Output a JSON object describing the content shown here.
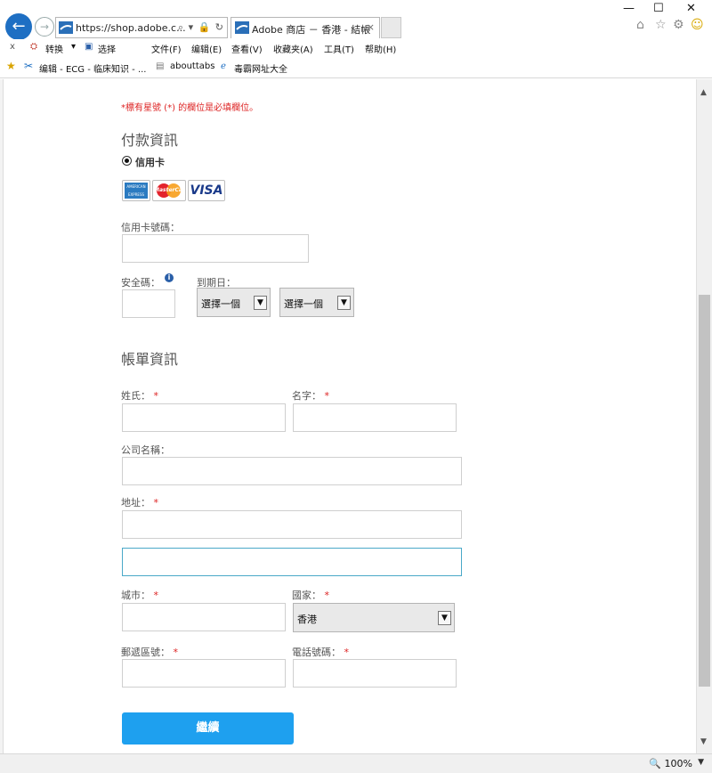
{
  "browser": {
    "address_url": "https://shop.adobe.c...",
    "address_tools": "⌕ ▾ 🔒 ↻",
    "tab_title": "Adobe 商店 － 香港 - 結帳",
    "tab_close": "×",
    "win_minimize": "—",
    "win_maximize": "☐",
    "win_close": "✕",
    "menu": {
      "close_x": "x",
      "convert": "转换",
      "select": "选择",
      "file": "文件(F)",
      "edit": "编辑(E)",
      "view": "查看(V)",
      "favorites": "收藏夹(A)",
      "tools": "工具(T)",
      "help": "帮助(H)"
    },
    "favorites": {
      "item1": "编辑 - ECG - 临床知识 - ...",
      "item2": "abouttabs",
      "item3": "毒霸网址大全"
    },
    "zoom": "100%"
  },
  "form": {
    "required_note": "*標有星號 (*) 的欄位是必填欄位。",
    "payment_heading": "付款資訊",
    "credit_card_label": "信用卡",
    "card_brands": {
      "amex": "AMERICAN EXPRESS",
      "mastercard": "MasterCard",
      "visa": "VISA"
    },
    "card_number_label": "信用卡號碼：",
    "security_code_label": "安全碼：",
    "expiry_label": "到期日：",
    "month_select": "選擇一個",
    "year_select": "選擇一個",
    "billing_heading": "帳單資訊",
    "last_name_label": "姓氏：",
    "first_name_label": "名字：",
    "company_label": "公司名稱：",
    "address_label": "地址：",
    "city_label": "城市：",
    "country_label": "國家：",
    "country_value": "香港",
    "postal_label": "郵遞區號：",
    "phone_label": "電話號碼：",
    "required_star": "*",
    "continue_button": "繼續"
  },
  "colors": {
    "accent": "#1ea0ef",
    "required": "#dd2222",
    "ie_blue": "#1e6fc3"
  }
}
